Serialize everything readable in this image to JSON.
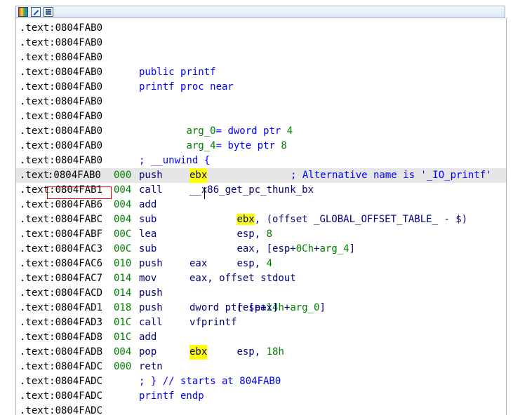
{
  "toolbar": {
    "icons": [
      "palette-icon",
      "edit-icon",
      "listing-icon"
    ]
  },
  "lines": [
    {
      "addr": ".text:0804FAB0"
    },
    {
      "addr": ".text:0804FAB0"
    },
    {
      "addr": ".text:0804FAB0"
    },
    {
      "addr": ".text:0804FAB0",
      "directive": "public printf"
    },
    {
      "addr": ".text:0804FAB0",
      "directive": "printf proc near"
    },
    {
      "addr": ".text:0804FAB0"
    },
    {
      "addr": ".text:0804FAB0",
      "arg_name": "arg_0",
      "arg_def": "= dword ptr ",
      "arg_val": "4"
    },
    {
      "addr": ".text:0804FAB0",
      "arg_name": "arg_4",
      "arg_def": "= byte ptr ",
      "arg_val": "8"
    },
    {
      "addr": ".text:0804FAB0"
    },
    {
      "addr": ".text:0804FAB0",
      "directive": "; __unwind {"
    },
    {
      "addr_prefix": ".text",
      "addr_sel": ":0804FAB0",
      "off": "000",
      "mn": "push",
      "op_hl": "ebx",
      "comment": "; Alternative name is '_IO_printf'",
      "current": true
    },
    {
      "addr": ".text:0804FAB1",
      "off": "004",
      "mn": "call",
      "op": "__x86_get_pc_thunk_bx"
    },
    {
      "addr": ".text:0804FAB6",
      "off": "004",
      "mn": "add",
      "op_hl": "ebx",
      "op_rest": ", (offset _GLOBAL_OFFSET_TABLE_ - $)"
    },
    {
      "addr": ".text:0804FABC",
      "off": "004",
      "mn": "sub",
      "op": "esp, ",
      "op_num": "8"
    },
    {
      "addr": ".text:0804FABF",
      "off": "00C",
      "mn": "lea",
      "op": "eax, [esp+",
      "op_num": "0Ch",
      "op_plus": "+",
      "op_arg": "arg_4",
      "op_end": "]"
    },
    {
      "addr": ".text:0804FAC3",
      "off": "00C",
      "mn": "sub",
      "op": "esp, ",
      "op_num": "4"
    },
    {
      "addr": ".text:0804FAC6",
      "off": "010",
      "mn": "push",
      "op": "eax"
    },
    {
      "addr": ".text:0804FAC7",
      "off": "014",
      "mn": "mov",
      "op": "eax, offset stdout"
    },
    {
      "addr": ".text:0804FACD",
      "off": "014",
      "mn": "push",
      "op": "[esp+",
      "op_num": "14h",
      "op_plus": "+",
      "op_arg": "arg_0",
      "op_end": "]"
    },
    {
      "addr": ".text:0804FAD1",
      "off": "018",
      "mn": "push",
      "op": "dword ptr [eax]"
    },
    {
      "addr": ".text:0804FAD3",
      "off": "01C",
      "mn": "call",
      "op": "vfprintf"
    },
    {
      "addr": ".text:0804FAD8",
      "off": "01C",
      "mn": "add",
      "op": "esp, ",
      "op_num": "18h"
    },
    {
      "addr": ".text:0804FADB",
      "off": "004",
      "mn": "pop",
      "op_hl": "ebx"
    },
    {
      "addr": ".text:0804FADC",
      "off": "000",
      "mn": "retn"
    },
    {
      "addr": ".text:0804FADC",
      "directive": "; } // starts at 804FAB0"
    },
    {
      "addr": ".text:0804FADC",
      "directive": "printf endp"
    },
    {
      "addr": ".text:0804FADC"
    }
  ]
}
